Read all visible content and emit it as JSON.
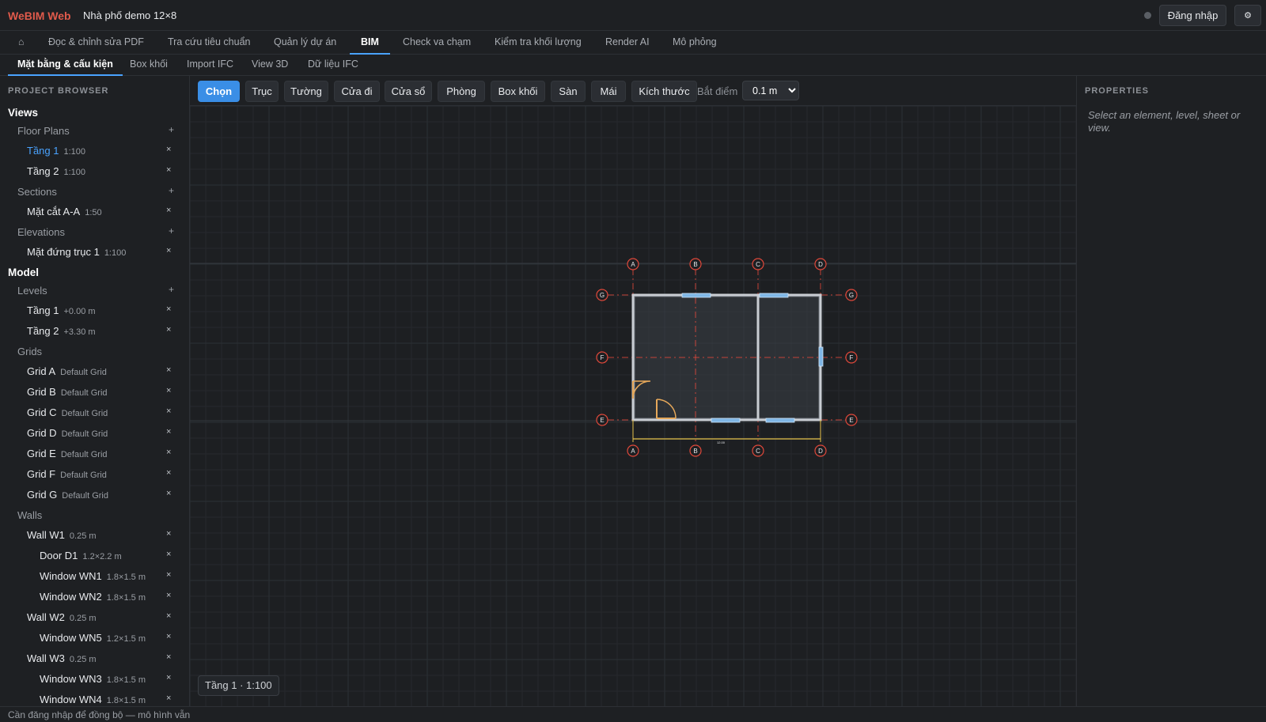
{
  "app": {
    "brand": "WeBIM Web",
    "doc_title": "Nhà phố demo 12×8",
    "login_label": "Đăng nhập",
    "settings_icon": "gear-icon",
    "settings_glyph": "⚙"
  },
  "main_nav": {
    "home_glyph": "⌂",
    "items": [
      "Đọc & chỉnh sửa PDF",
      "Tra cứu tiêu chuẩn",
      "Quản lý dự án",
      "BIM",
      "Check va chạm",
      "Kiểm tra khối lượng",
      "Render AI",
      "Mô phỏng"
    ],
    "active": "BIM"
  },
  "sub_nav": {
    "items": [
      "Mặt bằng & cấu kiện",
      "Box khối",
      "Import IFC",
      "View 3D",
      "Dữ liệu IFC"
    ],
    "active": "Mặt bằng & cấu kiện"
  },
  "sidebar": {
    "title": "PROJECT BROWSER",
    "rows": [
      {
        "type": "section",
        "label": "Views"
      },
      {
        "type": "group",
        "label": "Floor Plans",
        "add": true
      },
      {
        "type": "item",
        "label": "Tầng 1",
        "meta": "1:100",
        "selected": true
      },
      {
        "type": "item",
        "label": "Tầng 2",
        "meta": "1:100"
      },
      {
        "type": "group",
        "label": "Sections",
        "add": true
      },
      {
        "type": "item",
        "label": "Mặt cắt A-A",
        "meta": "1:50"
      },
      {
        "type": "group",
        "label": "Elevations",
        "add": true
      },
      {
        "type": "item",
        "label": "Mặt đứng trục 1",
        "meta": "1:100"
      },
      {
        "type": "section",
        "label": "Model"
      },
      {
        "type": "group",
        "label": "Levels",
        "add": true
      },
      {
        "type": "item",
        "label": "Tầng 1",
        "meta": "+0.00 m"
      },
      {
        "type": "item",
        "label": "Tầng 2",
        "meta": "+3.30 m"
      },
      {
        "type": "group",
        "label": "Grids"
      },
      {
        "type": "item",
        "label": "Grid A",
        "meta": "Default Grid"
      },
      {
        "type": "item",
        "label": "Grid B",
        "meta": "Default Grid"
      },
      {
        "type": "item",
        "label": "Grid C",
        "meta": "Default Grid"
      },
      {
        "type": "item",
        "label": "Grid D",
        "meta": "Default Grid"
      },
      {
        "type": "item",
        "label": "Grid E",
        "meta": "Default Grid"
      },
      {
        "type": "item",
        "label": "Grid F",
        "meta": "Default Grid"
      },
      {
        "type": "item",
        "label": "Grid G",
        "meta": "Default Grid"
      },
      {
        "type": "group",
        "label": "Walls"
      },
      {
        "type": "item",
        "label": "Wall W1",
        "meta": "0.25 m"
      },
      {
        "type": "subitem",
        "label": "Door D1",
        "meta": "1.2×2.2 m"
      },
      {
        "type": "subitem",
        "label": "Window WN1",
        "meta": "1.8×1.5 m"
      },
      {
        "type": "subitem",
        "label": "Window WN2",
        "meta": "1.8×1.5 m"
      },
      {
        "type": "item",
        "label": "Wall W2",
        "meta": "0.25 m"
      },
      {
        "type": "subitem",
        "label": "Window WN5",
        "meta": "1.2×1.5 m"
      },
      {
        "type": "item",
        "label": "Wall W3",
        "meta": "0.25 m"
      },
      {
        "type": "subitem",
        "label": "Window WN3",
        "meta": "1.8×1.5 m"
      },
      {
        "type": "subitem",
        "label": "Window WN4",
        "meta": "1.8×1.5 m"
      }
    ],
    "delete_glyph": "×",
    "add_glyph": "+"
  },
  "toolbar": {
    "tools": [
      "Chọn",
      "Trục",
      "Tường",
      "Cửa đi",
      "Cửa sổ",
      "Phòng",
      "Box khối",
      "Sàn",
      "Mái",
      "Kích thước"
    ],
    "active": "Chọn",
    "snap_label": "Bắt điểm",
    "snap_value": "0.1 m",
    "snap_options": [
      "0.1 m"
    ]
  },
  "canvas": {
    "view_badge": "Tầng 1 · 1:100",
    "grid_labels": {
      "vertical": [
        "A",
        "B",
        "C",
        "D"
      ],
      "horizontal": [
        "G",
        "F",
        "E"
      ]
    },
    "dimension_text": "12.00",
    "colors": {
      "grid_line": "#e0483a",
      "wall": "#c9cdd3",
      "window": "#7fb6e6",
      "door": "#e6a85a",
      "dimension": "#e6c24a",
      "room_fill": "#3a3f47"
    }
  },
  "properties": {
    "title": "PROPERTIES",
    "empty_text": "Select an element, level, sheet or view."
  },
  "status": {
    "message": "Cần đăng nhập để đồng bộ — mô hình vẫn được lưu cục bộ"
  }
}
